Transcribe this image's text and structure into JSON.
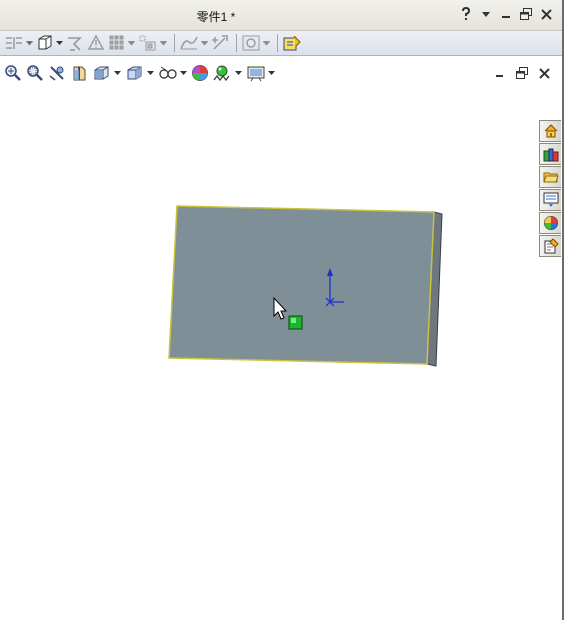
{
  "window": {
    "title": "零件1 *"
  },
  "titlebar_buttons": [
    "help-icon",
    "dropdown-arrow-icon",
    "minimize-icon",
    "restore-icon",
    "close-icon"
  ],
  "command_toolbar": {
    "items": [
      "mirror-icon",
      "extrude-icon",
      "hole-wizard-icon",
      "draft-icon",
      "linear-pattern-icon",
      "reference-geometry-icon",
      "sketch-relation-icon",
      "smart-dimension-icon",
      "display-style-icon",
      "options-icon"
    ]
  },
  "view_toolbar": {
    "items": [
      "zoom-to-fit-icon",
      "zoom-to-area-icon",
      "previous-view-icon",
      "section-view-icon",
      "view-orientation-icon",
      "display-style-icon",
      "hide-show-items-icon",
      "edit-appearance-icon",
      "apply-scene-icon",
      "view-settings-icon"
    ]
  },
  "task_pane": {
    "tabs": [
      "solidworks-resources-icon",
      "design-library-icon",
      "file-explorer-icon",
      "view-palette-icon",
      "appearances-icon",
      "custom-properties-icon"
    ]
  },
  "colors": {
    "part_face": "#7f8f97",
    "part_side": "#6d7780",
    "part_edge": "#c9c43a",
    "origin_axis": "#1a2bd8",
    "selection_handle": "#18b82a"
  }
}
